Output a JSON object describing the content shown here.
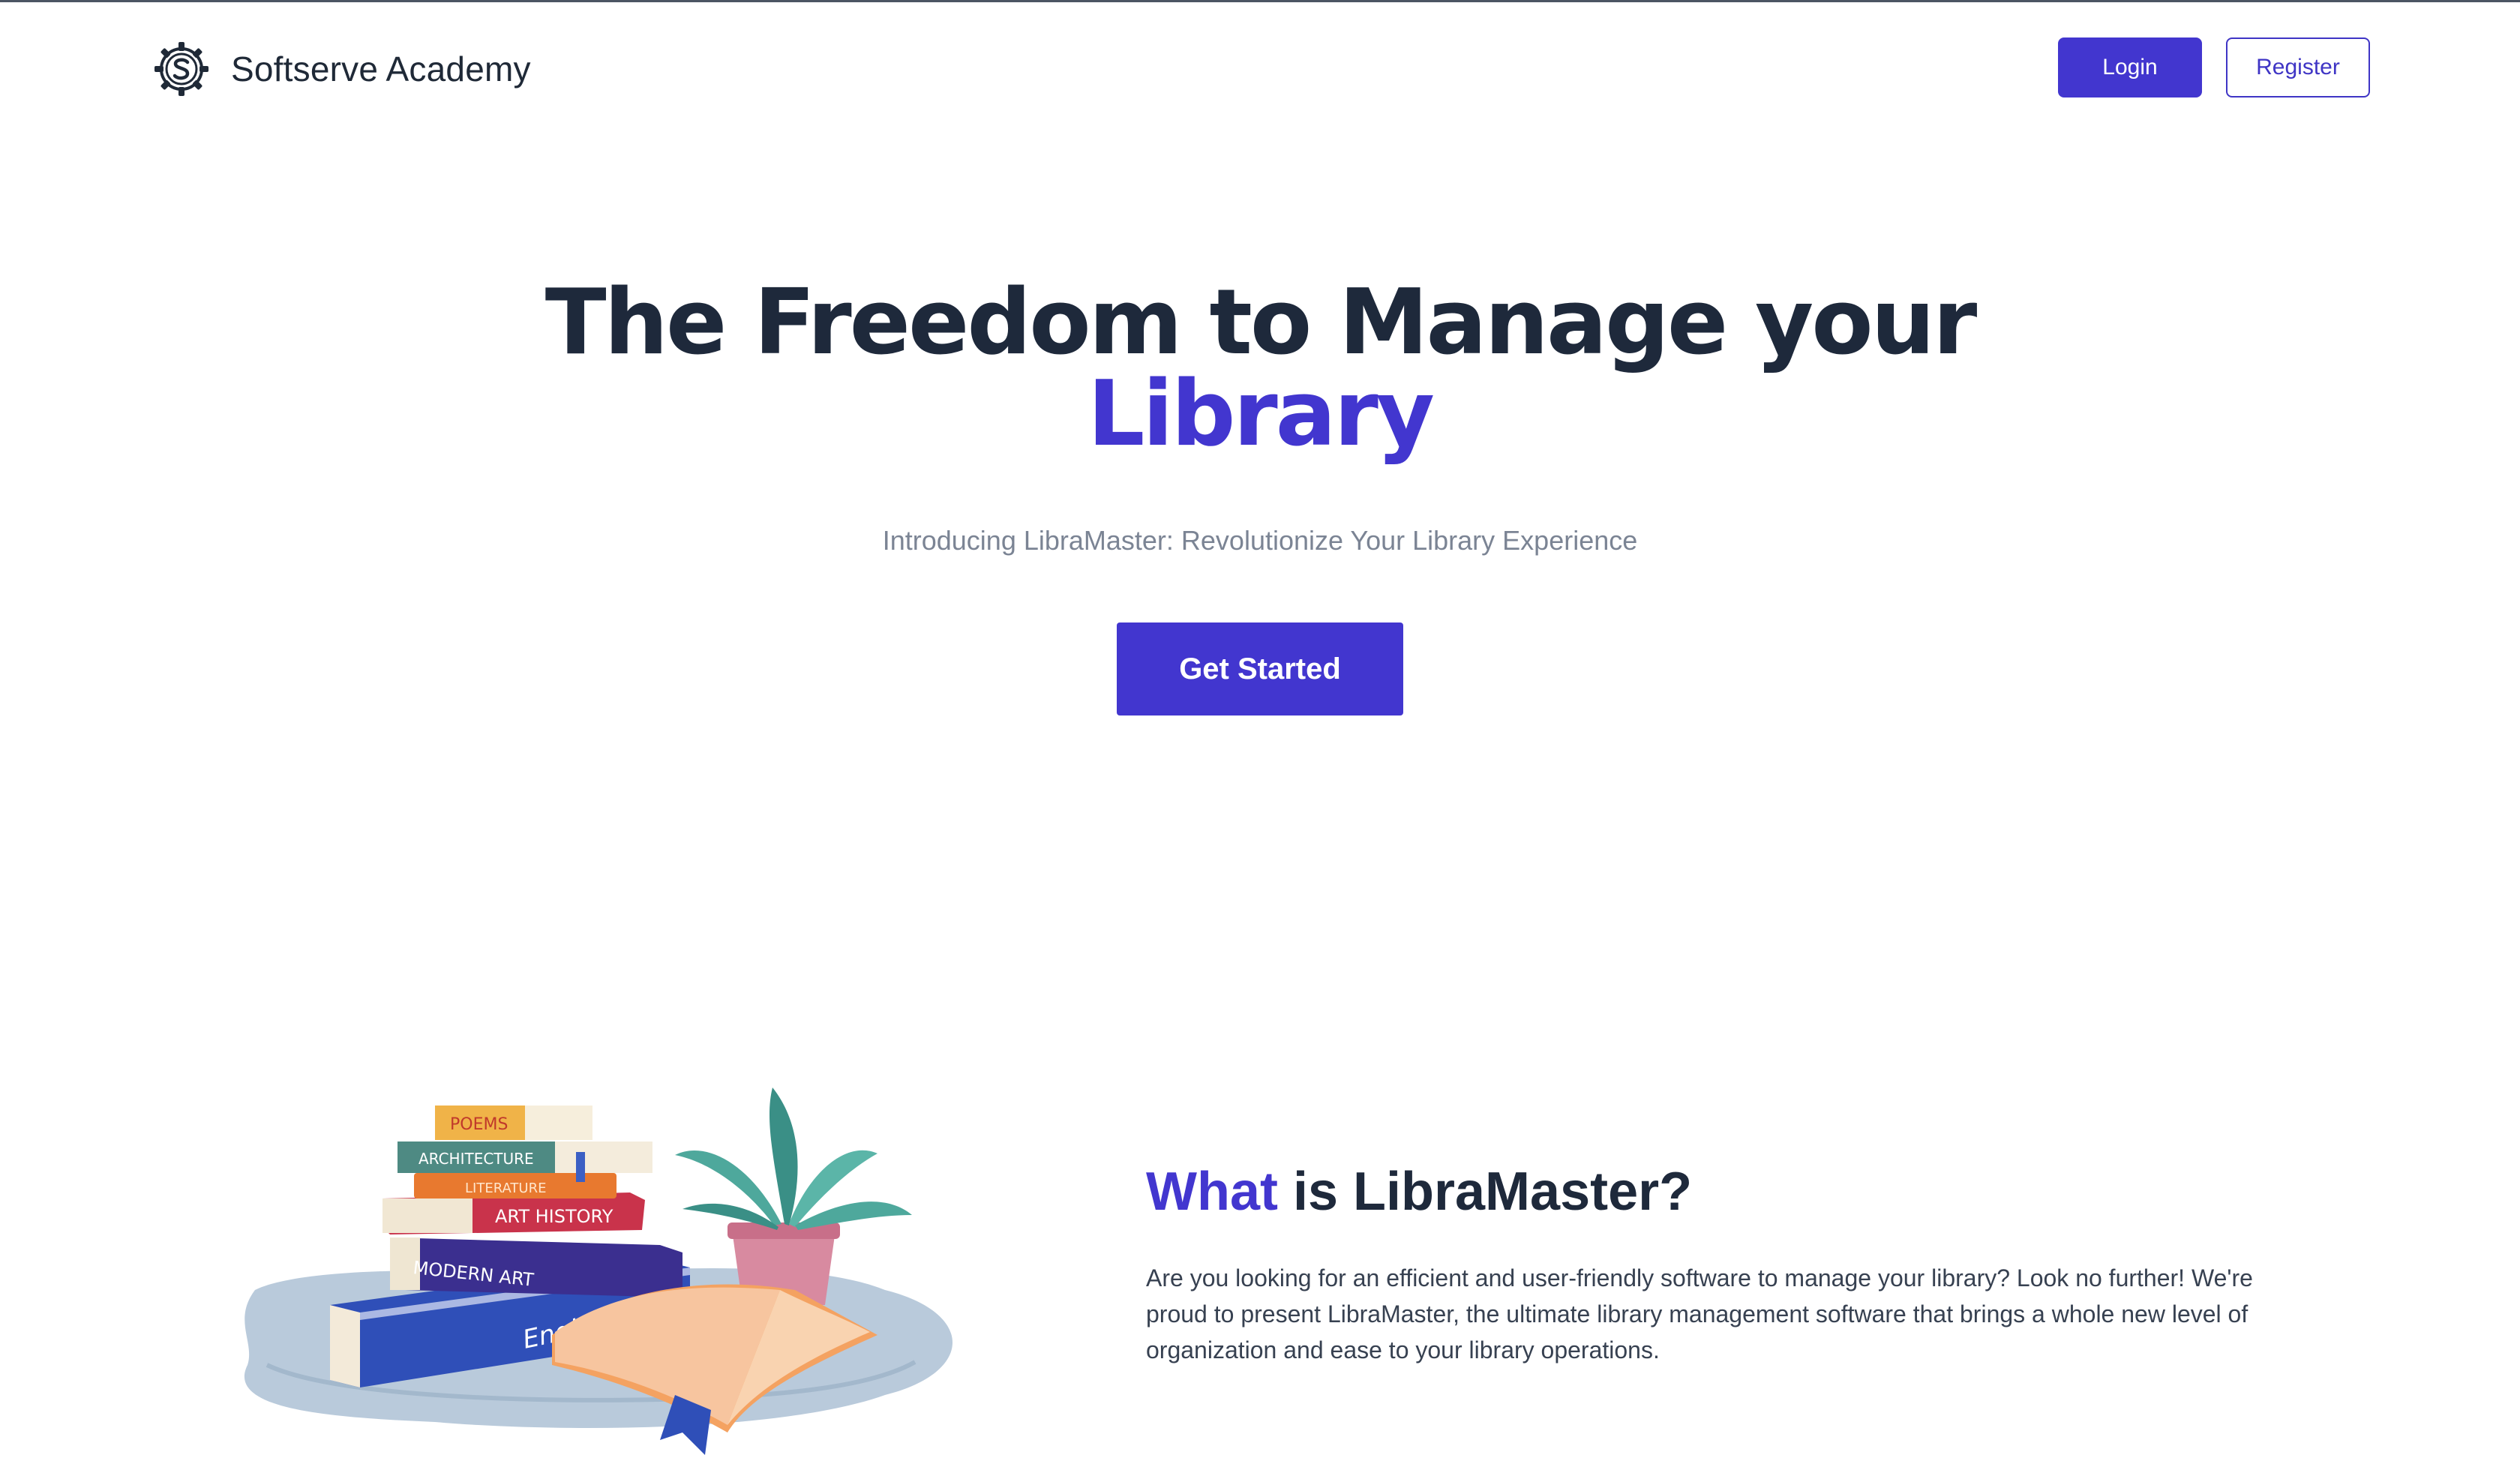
{
  "header": {
    "brand_name": "Softserve Academy",
    "login_label": "Login",
    "register_label": "Register"
  },
  "hero": {
    "title_line1": "The Freedom to Manage your",
    "title_accent": "Library",
    "subtitle": "Introducing LibraMaster: Revolutionize Your Library Experience",
    "cta_label": "Get Started"
  },
  "illustration": {
    "book_labels": [
      "POEMS",
      "ARCHITECTURE",
      "LITERATURE",
      "ART HISTORY",
      "MODERN ART",
      "English"
    ]
  },
  "about": {
    "title_accent": "What",
    "title_rest": " is LibraMaster?",
    "body": "Are you looking for an efficient and user-friendly software to manage your library? Look no further! We're proud to present LibraMaster, the ultimate library management software that brings a whole new level of organization and ease to your library operations."
  },
  "colors": {
    "accent": "#4236cf",
    "heading": "#1e293b",
    "muted": "#7b8494"
  },
  "icons": [
    "softserve-gear-logo-icon"
  ]
}
